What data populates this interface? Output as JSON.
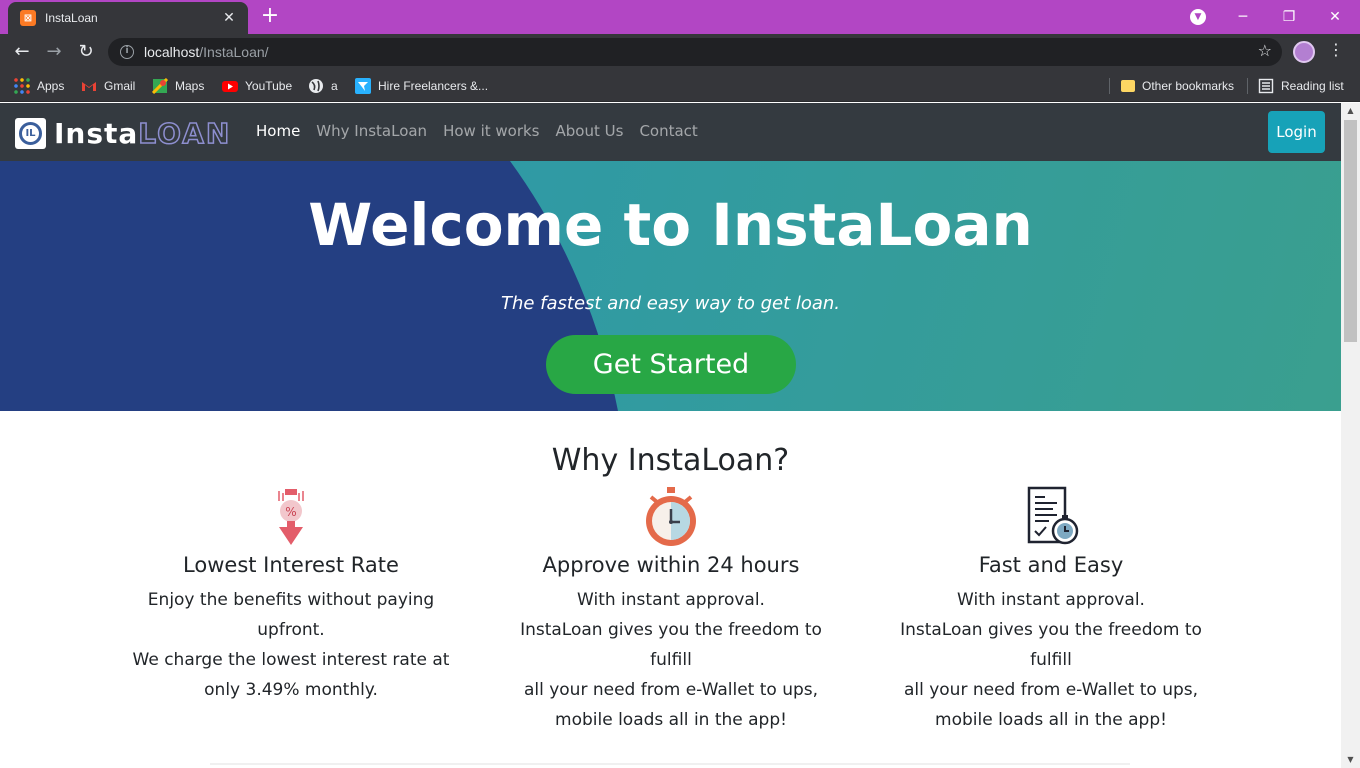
{
  "browser": {
    "tab_title": "InstaLoan",
    "tab_favicon": "XAMPP-icon",
    "new_tab": "+",
    "url_host": "localhost",
    "url_path": "/InstaLoan/",
    "bookmarks": [
      {
        "label": "Apps",
        "icon": "apps-grid-icon"
      },
      {
        "label": "Gmail",
        "icon": "gmail-icon"
      },
      {
        "label": "Maps",
        "icon": "maps-icon"
      },
      {
        "label": "YouTube",
        "icon": "youtube-icon"
      },
      {
        "label": "a",
        "icon": "globe-icon"
      },
      {
        "label": "Hire Freelancers &...",
        "icon": "freelancer-icon"
      }
    ],
    "other_bookmarks": "Other bookmarks",
    "reading_list": "Reading list"
  },
  "site": {
    "logo_insta": "Insta",
    "logo_loan": "LOAN",
    "nav": [
      "Home",
      "Why InstaLoan",
      "How it works",
      "About Us",
      "Contact"
    ],
    "login": "Login"
  },
  "hero": {
    "title": "Welcome to InstaLoan",
    "subtitle": "The fastest and easy way to get loan.",
    "cta": "Get Started"
  },
  "why": {
    "title": "Why InstaLoan?",
    "features": [
      {
        "icon": "interest-rate-down-icon",
        "title": "Lowest Interest Rate",
        "lines": [
          "Enjoy the benefits without paying",
          "upfront.",
          "We charge the lowest interest rate at",
          "only 3.49% monthly."
        ]
      },
      {
        "icon": "stopwatch-icon",
        "title": "Approve within 24 hours",
        "lines": [
          "With instant approval.",
          "InstaLoan gives you the freedom to",
          "fulfill",
          "all your need from e-Wallet to ups,",
          "mobile loads all in the app!"
        ]
      },
      {
        "icon": "document-timer-icon",
        "title": "Fast and Easy",
        "lines": [
          "With instant approval.",
          "InstaLoan gives you the freedom to",
          "fulfill",
          "all your need from e-Wallet to ups,",
          "mobile loads all in the app!"
        ]
      }
    ]
  },
  "colors": {
    "tabstrip": "#b246c4",
    "navbar": "#343a40",
    "login": "#17a2b8",
    "cta": "#28a745",
    "hero_dark": "#243f82",
    "hero_light": "#2997b1"
  }
}
